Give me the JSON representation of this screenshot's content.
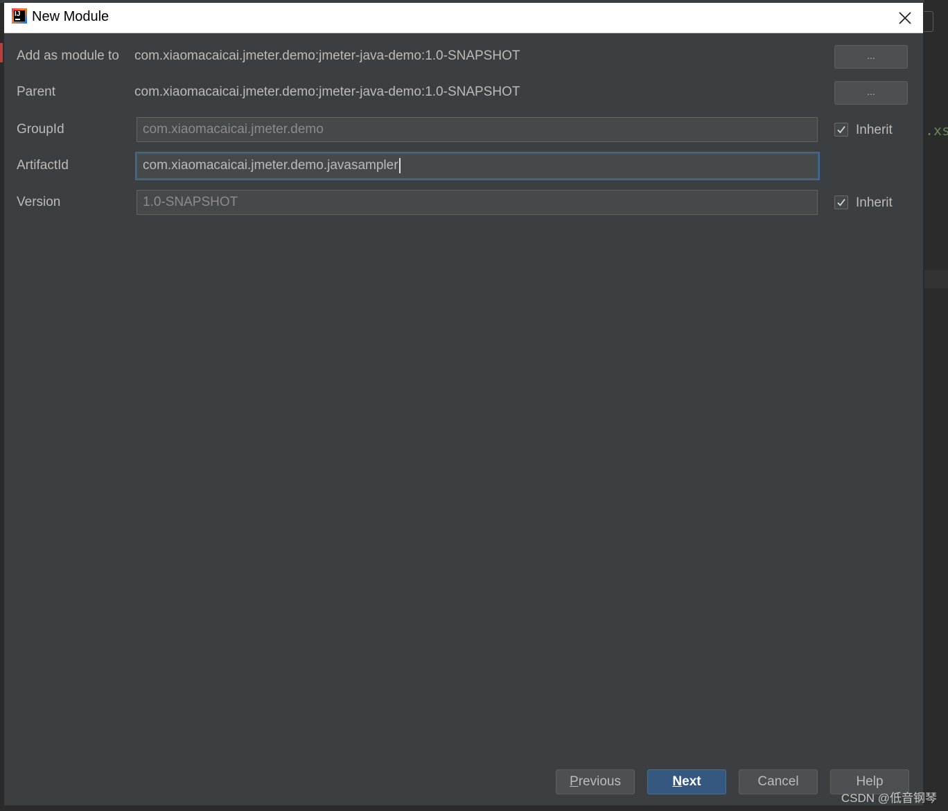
{
  "window": {
    "title": "New Module",
    "icon": "intellij-idea-icon",
    "close_icon": "close-icon"
  },
  "form": {
    "add_as_module_to": {
      "label": "Add as module to",
      "value": "com.xiaomacaicai.jmeter.demo:jmeter-java-demo:1.0-SNAPSHOT",
      "button": "..."
    },
    "parent": {
      "label": "Parent",
      "value": "com.xiaomacaicai.jmeter.demo:jmeter-java-demo:1.0-SNAPSHOT",
      "button": "..."
    },
    "group_id": {
      "label": "GroupId",
      "value": "com.xiaomacaicai.jmeter.demo",
      "inherit_label": "Inherit",
      "inherit_checked": true
    },
    "artifact_id": {
      "label": "ArtifactId",
      "value": "com.xiaomacaicai.jmeter.demo.javasampler"
    },
    "version": {
      "label": "Version",
      "value": "1.0-SNAPSHOT",
      "inherit_label": "Inherit",
      "inherit_checked": true
    }
  },
  "footer": {
    "previous": {
      "mnemonic": "P",
      "rest": "revious"
    },
    "next": {
      "mnemonic": "N",
      "rest": "ext"
    },
    "cancel": "Cancel",
    "help": "Help"
  },
  "background": {
    "code_fragment": ".xs"
  },
  "watermark": "CSDN @低音钢琴",
  "colors": {
    "dialog_bg": "#3c3f41",
    "primary_button": "#365880",
    "focus_border": "#3d6185"
  }
}
